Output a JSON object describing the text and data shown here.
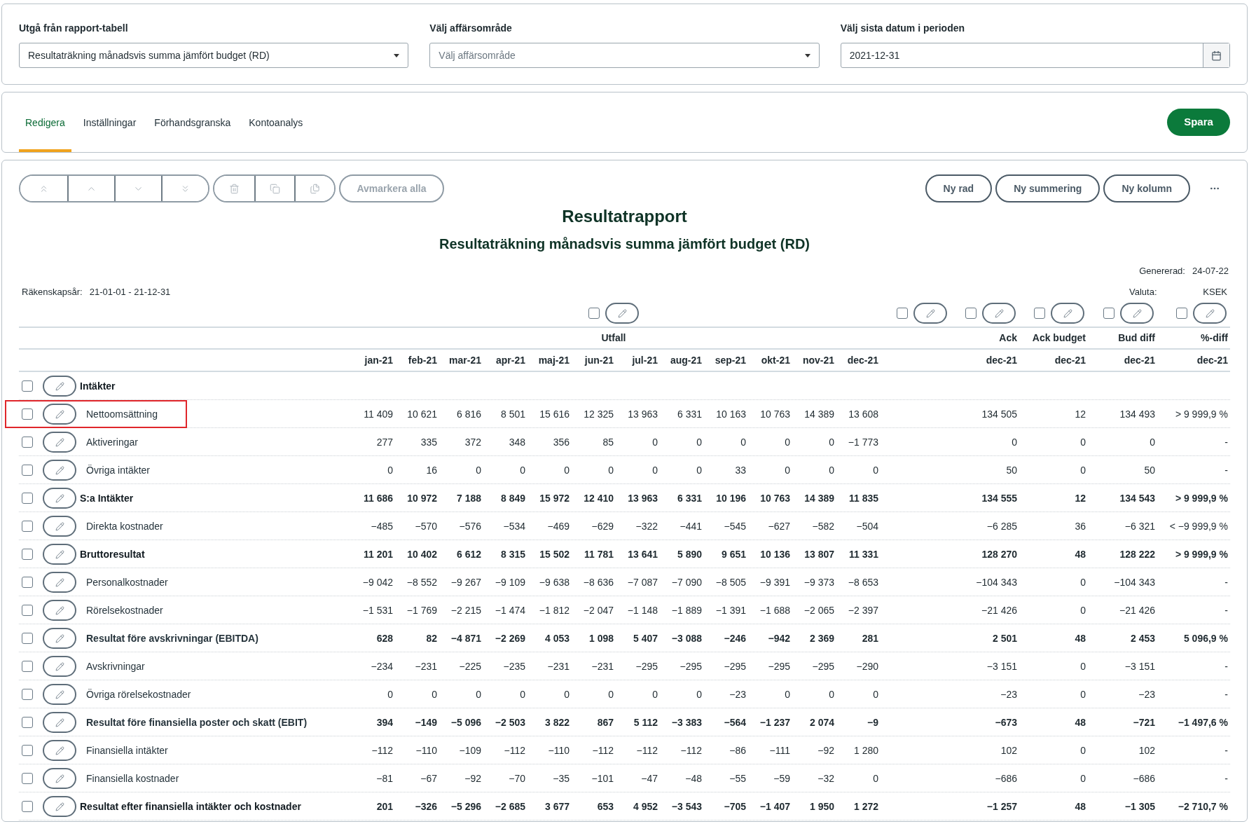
{
  "filters": [
    {
      "kind": "select",
      "label": "Utgå från rapport-tabell",
      "value": "Resultaträkning månadsvis summa jämfört budget (RD)"
    },
    {
      "kind": "select",
      "label": "Välj affärsområde",
      "placeholder": "Välj affärsområde"
    },
    {
      "kind": "date",
      "label": "Välj sista datum i perioden",
      "value": "2021-12-31"
    }
  ],
  "tabs": [
    {
      "label": "Redigera",
      "selected": true
    },
    {
      "label": "Inställningar",
      "selected": false
    },
    {
      "label": "Förhandsgranska",
      "selected": false
    },
    {
      "label": "Kontoanalys",
      "selected": false
    }
  ],
  "save_button": "Spara",
  "toolbar": {
    "icon_buttons_disabled": true,
    "deselect": {
      "label": "Avmarkera alla",
      "disabled": true
    },
    "actions": [
      {
        "label": "Ny rad",
        "disabled": false
      },
      {
        "label": "Ny summering",
        "disabled": false
      },
      {
        "label": "Ny kolumn",
        "disabled": false
      }
    ]
  },
  "report": {
    "title": "Resultatrapport",
    "subtitle": "Resultaträkning månadsvis summa jämfört budget (RD)",
    "fiscal_year": {
      "label": "Räkenskapsår:",
      "value": "21-01-01 - 21-12-31"
    },
    "generated": {
      "label": "Genererad:",
      "value": "24-07-22"
    },
    "currency": {
      "label": "Valuta:",
      "value": "KSEK"
    }
  },
  "column_groups": [
    {
      "kind": "months",
      "checked": false,
      "header": "Utfall",
      "subheaders": [
        "jan-21",
        "feb-21",
        "mar-21",
        "apr-21",
        "maj-21",
        "jun-21",
        "jul-21",
        "aug-21",
        "sep-21",
        "okt-21",
        "nov-21",
        "dec-21"
      ]
    },
    {
      "kind": "blank",
      "checked": false
    },
    {
      "kind": "single",
      "checked": false,
      "header": "Ack",
      "subheader": "dec-21"
    },
    {
      "kind": "single",
      "checked": false,
      "header": "Ack budget",
      "subheader": "dec-21"
    },
    {
      "kind": "single",
      "checked": false,
      "header": "Bud diff",
      "subheader": "dec-21"
    },
    {
      "kind": "single",
      "checked": false,
      "header": "%-diff",
      "subheader": "dec-21"
    }
  ],
  "rows": [
    {
      "label": "Intäkter",
      "bold": true,
      "indented": false,
      "checked": false,
      "highlighted": false
    },
    {
      "label": "Nettoomsättning",
      "bold": false,
      "indented": true,
      "checked": false,
      "highlighted": true,
      "months": [
        "11 409",
        "10 621",
        "6 816",
        "8 501",
        "15 616",
        "12 325",
        "13 963",
        "6 331",
        "10 163",
        "10 763",
        "14 389",
        "13 608"
      ],
      "totals": [
        "134 505",
        "12",
        "134 493",
        "> 9 999,9 %"
      ]
    },
    {
      "label": "Aktiveringar",
      "bold": false,
      "indented": true,
      "checked": false,
      "highlighted": false,
      "months": [
        "277",
        "335",
        "372",
        "348",
        "356",
        "85",
        "0",
        "0",
        "0",
        "0",
        "0",
        "−1 773"
      ],
      "totals": [
        "0",
        "0",
        "0",
        "-"
      ]
    },
    {
      "label": "Övriga intäkter",
      "bold": false,
      "indented": true,
      "checked": false,
      "highlighted": false,
      "months": [
        "0",
        "16",
        "0",
        "0",
        "0",
        "0",
        "0",
        "0",
        "33",
        "0",
        "0",
        "0"
      ],
      "totals": [
        "50",
        "0",
        "50",
        "-"
      ]
    },
    {
      "label": "S:a Intäkter",
      "bold": true,
      "indented": false,
      "checked": false,
      "highlighted": false,
      "months": [
        "11 686",
        "10 972",
        "7 188",
        "8 849",
        "15 972",
        "12 410",
        "13 963",
        "6 331",
        "10 196",
        "10 763",
        "14 389",
        "11 835"
      ],
      "totals": [
        "134 555",
        "12",
        "134 543",
        "> 9 999,9 %"
      ]
    },
    {
      "label": "Direkta kostnader",
      "bold": false,
      "indented": true,
      "checked": false,
      "highlighted": false,
      "months": [
        "−485",
        "−570",
        "−576",
        "−534",
        "−469",
        "−629",
        "−322",
        "−441",
        "−545",
        "−627",
        "−582",
        "−504"
      ],
      "totals": [
        "−6 285",
        "36",
        "−6 321",
        "< −9 999,9 %"
      ]
    },
    {
      "label": "Bruttoresultat",
      "bold": true,
      "indented": false,
      "checked": false,
      "highlighted": false,
      "months": [
        "11 201",
        "10 402",
        "6 612",
        "8 315",
        "15 502",
        "11 781",
        "13 641",
        "5 890",
        "9 651",
        "10 136",
        "13 807",
        "11 331"
      ],
      "totals": [
        "128 270",
        "48",
        "128 222",
        "> 9 999,9 %"
      ]
    },
    {
      "label": "Personalkostnader",
      "bold": false,
      "indented": true,
      "checked": false,
      "highlighted": false,
      "months": [
        "−9 042",
        "−8 552",
        "−9 267",
        "−9 109",
        "−9 638",
        "−8 636",
        "−7 087",
        "−7 090",
        "−8 505",
        "−9 391",
        "−9 373",
        "−8 653"
      ],
      "totals": [
        "−104 343",
        "0",
        "−104 343",
        "-"
      ]
    },
    {
      "label": "Rörelsekostnader",
      "bold": false,
      "indented": true,
      "checked": false,
      "highlighted": false,
      "months": [
        "−1 531",
        "−1 769",
        "−2 215",
        "−1 474",
        "−1 812",
        "−2 047",
        "−1 148",
        "−1 889",
        "−1 391",
        "−1 688",
        "−2 065",
        "−2 397"
      ],
      "totals": [
        "−21 426",
        "0",
        "−21 426",
        "-"
      ]
    },
    {
      "label": "Resultat före avskrivningar (EBITDA)",
      "bold": true,
      "indented": true,
      "checked": false,
      "highlighted": false,
      "months": [
        "628",
        "82",
        "−4 871",
        "−2 269",
        "4 053",
        "1 098",
        "5 407",
        "−3 088",
        "−246",
        "−942",
        "2 369",
        "281"
      ],
      "totals": [
        "2 501",
        "48",
        "2 453",
        "5 096,9 %"
      ]
    },
    {
      "label": "Avskrivningar",
      "bold": false,
      "indented": true,
      "checked": false,
      "highlighted": false,
      "months": [
        "−234",
        "−231",
        "−225",
        "−235",
        "−231",
        "−231",
        "−295",
        "−295",
        "−295",
        "−295",
        "−295",
        "−290"
      ],
      "totals": [
        "−3 151",
        "0",
        "−3 151",
        "-"
      ]
    },
    {
      "label": "Övriga rörelsekostnader",
      "bold": false,
      "indented": true,
      "checked": false,
      "highlighted": false,
      "months": [
        "0",
        "0",
        "0",
        "0",
        "0",
        "0",
        "0",
        "0",
        "−23",
        "0",
        "0",
        "0"
      ],
      "totals": [
        "−23",
        "0",
        "−23",
        "-"
      ]
    },
    {
      "label": "Resultat före finansiella poster och skatt (EBIT)",
      "bold": true,
      "indented": true,
      "checked": false,
      "highlighted": false,
      "months": [
        "394",
        "−149",
        "−5 096",
        "−2 503",
        "3 822",
        "867",
        "5 112",
        "−3 383",
        "−564",
        "−1 237",
        "2 074",
        "−9"
      ],
      "totals": [
        "−673",
        "48",
        "−721",
        "−1 497,6 %"
      ]
    },
    {
      "label": "Finansiella intäkter",
      "bold": false,
      "indented": true,
      "checked": false,
      "highlighted": false,
      "months": [
        "−112",
        "−110",
        "−109",
        "−112",
        "−110",
        "−112",
        "−112",
        "−112",
        "−86",
        "−111",
        "−92",
        "1 280"
      ],
      "totals": [
        "102",
        "0",
        "102",
        "-"
      ]
    },
    {
      "label": "Finansiella kostnader",
      "bold": false,
      "indented": true,
      "checked": false,
      "highlighted": false,
      "months": [
        "−81",
        "−67",
        "−92",
        "−70",
        "−35",
        "−101",
        "−47",
        "−48",
        "−55",
        "−59",
        "−32",
        "0"
      ],
      "totals": [
        "−686",
        "0",
        "−686",
        "-"
      ]
    },
    {
      "label": "Resultat efter finansiella intäkter och kostnader",
      "bold": true,
      "indented": false,
      "checked": false,
      "highlighted": false,
      "months": [
        "201",
        "−326",
        "−5 296",
        "−2 685",
        "3 677",
        "653",
        "4 952",
        "−3 543",
        "−705",
        "−1 407",
        "1 950",
        "1 272"
      ],
      "totals": [
        "−1 257",
        "48",
        "−1 305",
        "−2 710,7 %"
      ]
    }
  ]
}
